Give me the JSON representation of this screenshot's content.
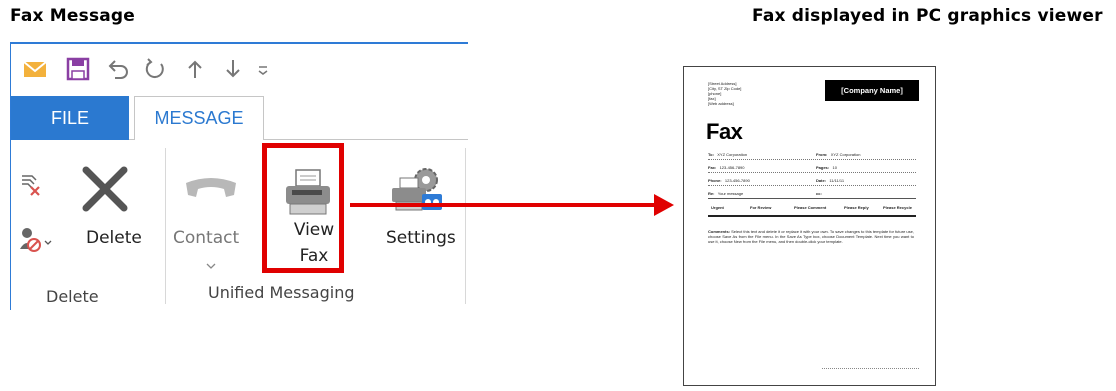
{
  "titles": {
    "left": "Fax Message",
    "right": "Fax displayed in PC graphics viewer"
  },
  "ribbon": {
    "tabs": {
      "file": "FILE",
      "message": "MESSAGE"
    },
    "buttons": {
      "delete": "Delete",
      "contact": "Contact",
      "view_fax_line1": "View",
      "view_fax_line2": "Fax",
      "settings": "Settings"
    },
    "groups": {
      "delete": "Delete",
      "unified": "Unified Messaging"
    },
    "colors": {
      "accent": "#2b79d0",
      "highlight": "#e00000"
    }
  },
  "fax": {
    "address_lines": [
      "[Street Address]",
      "[City, ST Zip Code]",
      "[phone]",
      "[fax]",
      "[Web address]"
    ],
    "company": "[Company Name]",
    "heading": "Fax",
    "to_label": "To:",
    "to_value": "XYZ Corporation",
    "from_label": "From:",
    "from_value": "XYZ Corporation",
    "fax_label": "Fax:",
    "fax_value": "123-456-7890",
    "pages_label": "Pages:",
    "pages_value": "10",
    "phone_label": "Phone:",
    "phone_value": "123-456-7890",
    "date_label": "Date:",
    "date_value": "11/11/11",
    "re_label": "Re:",
    "re_value": "Your message",
    "cc_label": "cc:",
    "checks": [
      "Urgent",
      "For Review",
      "Please Comment",
      "Please Reply",
      "Please Recycle"
    ],
    "comments_label": "Comments:",
    "comments_text": "Select this text and delete it or replace it with your own. To save changes to this template for future use, choose Save As from the File menu. In the Save As Type box, choose Document Template. Next time you want to use it, choose New from the File menu, and then double-click your template."
  }
}
